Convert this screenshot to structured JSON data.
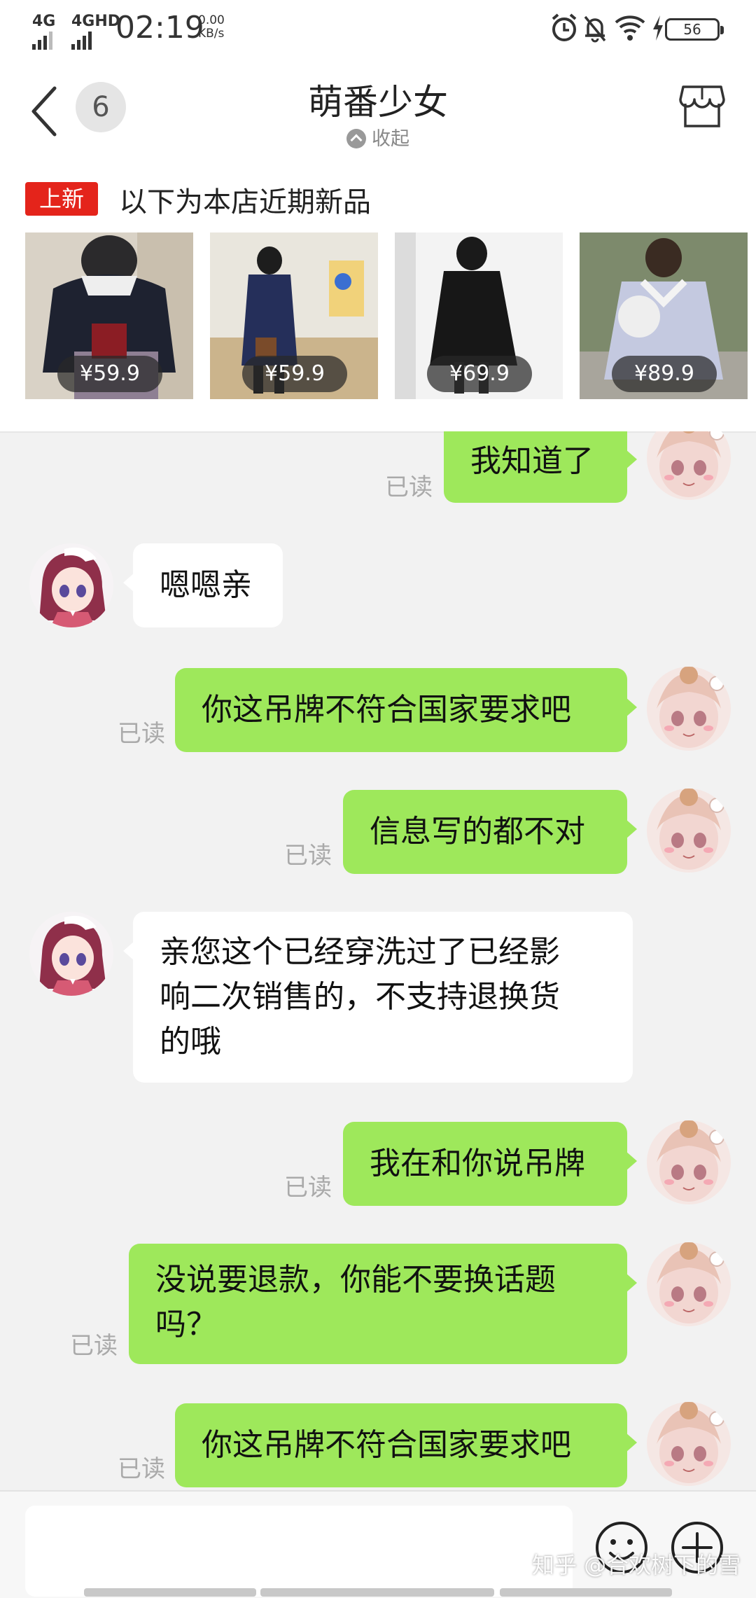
{
  "status_bar": {
    "net1": "4G",
    "net2": "4GHD",
    "time": "02:19",
    "speed_value": "0.00",
    "speed_unit": "KB/s",
    "battery": "56",
    "icons": [
      "alarm-icon",
      "bell-off-icon",
      "wifi-icon",
      "charging-icon",
      "battery-icon"
    ]
  },
  "header": {
    "unread_count": "6",
    "title": "萌番少女",
    "collapse_label": "收起"
  },
  "new_arrivals": {
    "tag": "上新",
    "heading": "以下为本店近期新品",
    "products": [
      {
        "price": "¥59.9"
      },
      {
        "price": "¥59.9"
      },
      {
        "price": "¥69.9"
      },
      {
        "price": "¥89.9"
      }
    ]
  },
  "messages": [
    {
      "from": "me",
      "text": "我知道了",
      "status": "已读"
    },
    {
      "from": "shop",
      "text": "嗯嗯亲"
    },
    {
      "from": "me",
      "text": "你这吊牌不符合国家要求吧",
      "status": "已读"
    },
    {
      "from": "me",
      "text": "信息写的都不对",
      "status": "已读"
    },
    {
      "from": "shop",
      "text_lines": [
        "亲您这个已经穿洗过了已经影",
        "响二次销售的，不支持退换货",
        "的哦"
      ]
    },
    {
      "from": "me",
      "text": "我在和你说吊牌",
      "status": "已读"
    },
    {
      "from": "me",
      "text_lines": [
        "没说要退款，你能不要换话题",
        "吗？"
      ],
      "status": "已读"
    },
    {
      "from": "me",
      "text": "你这吊牌不符合国家要求吧",
      "status": "已读"
    }
  ],
  "watermark": "知乎 @合欢树下的雪",
  "colors": {
    "my_bubble": "#9ee85b",
    "shop_bubble": "#ffffff",
    "new_tag": "#e4241b",
    "chat_bg": "#f2f2f2"
  }
}
